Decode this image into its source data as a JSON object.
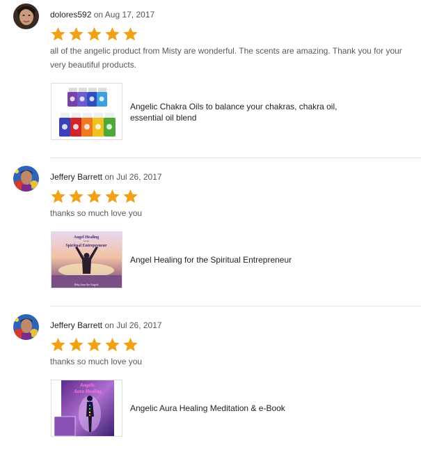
{
  "reviews": [
    {
      "author": "dolores592",
      "on_word": "on",
      "date": "Aug 17, 2017",
      "rating": 5,
      "text": "all of the angelic product from Misty are wonderful. The scents are amazing. Thank you for your very beautiful products.",
      "product": {
        "title": "Angelic Chakra Oils to balance your chakras, chakra oil, essential oil blend"
      }
    },
    {
      "author": "Jeffery Barrett",
      "on_word": "on",
      "date": "Jul 26, 2017",
      "rating": 5,
      "text": "thanks so much love you",
      "product": {
        "title": "Angel Healing for the Spiritual Entrepreneur",
        "image_text": [
          "Angel Healing",
          "for the",
          "Spiritual Entrepreneur",
          "Help from the Angels"
        ]
      }
    },
    {
      "author": "Jeffery Barrett",
      "on_word": "on",
      "date": "Jul 26, 2017",
      "rating": 5,
      "text": "thanks so much love you",
      "product": {
        "title": "Angelic Aura Healing Meditation & e-Book",
        "image_text": [
          "Angelic",
          "Aura Healing"
        ]
      }
    }
  ],
  "colors": {
    "star": "#f1a118",
    "divider": "#e3e3e3",
    "muted_text": "#595959"
  },
  "icons": {
    "star": "star-icon"
  }
}
